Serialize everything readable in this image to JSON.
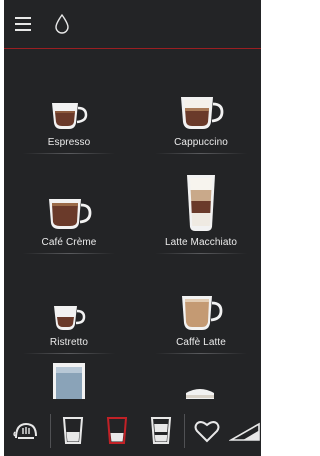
{
  "header": {
    "menu_icon": "hamburger-menu-icon",
    "drop_icon": "water-drop-icon",
    "divider_color": "#9b1f22"
  },
  "drinks": [
    {
      "label": "Espresso"
    },
    {
      "label": "Cappuccino"
    },
    {
      "label": "Café Crème"
    },
    {
      "label": "Latte Macchiato"
    },
    {
      "label": "Ristretto"
    },
    {
      "label": "Caffè Latte"
    }
  ],
  "bottom_bar": {
    "icons": [
      "steam-nozzle-icon",
      "single-glass-icon",
      "glass-selected-icon",
      "glass-icon",
      "heart-favorite-icon",
      "strength-ramp-icon"
    ],
    "accent_color": "#c22126"
  }
}
